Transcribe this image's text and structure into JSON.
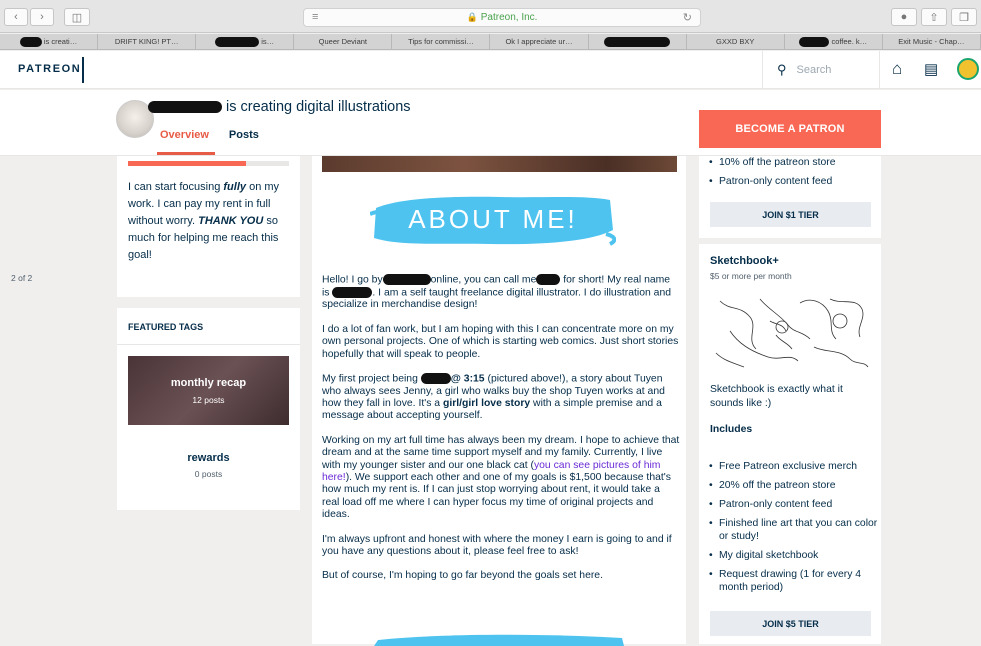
{
  "browser": {
    "address": "Patreon, Inc.",
    "tabs": [
      " is creati…",
      "DRIFT KING! PT…",
      "is…",
      "Queer Deviant",
      "Tips for commissi…",
      "Ok I appreciate ur…",
      "",
      "GXXD BXY",
      "coffee. k…",
      "Exit Music - Chap…"
    ]
  },
  "header": {
    "logo": "PATREON",
    "search_placeholder": "Search"
  },
  "creator": {
    "title_suffix": "is creating digital illustrations",
    "nav": {
      "overview": "Overview",
      "posts": "Posts"
    },
    "become_patron": "BECOME A PATRON"
  },
  "goal": {
    "progress": 0.73,
    "line1_pre": "I can start focusing ",
    "line1_em": "fully",
    "line1_post": " on my work. I can pay my rent in full without worry. ",
    "thanks": "THANK YOU",
    "line2": " so much for helping me reach this goal!",
    "count": "2 of 2"
  },
  "tags": {
    "title": "FEATURED TAGS",
    "items": [
      {
        "name": "monthly recap",
        "count": "12 posts"
      },
      {
        "name": "rewards",
        "count": "0 posts"
      }
    ]
  },
  "post": {
    "banner_text": "ABOUT ME!",
    "p1_a": "Hello! I go by",
    "p1_b": "online, you can call me",
    "p1_c": "for short! My real name is",
    "p1_d": ". I am a self taught freelance digital illustrator. I do illustration and specialize in merchandise design!",
    "p2": "I do a lot of fan work, but I am hoping with this I can concentrate more on my own personal projects. One of which is starting web comics. Just short stories hopefully that will speak to people.",
    "p3_a": "My first project being",
    "p3_bold1": "@ 3:15",
    "p3_b": " (pictured above!), a story about Tuyen who always sees Jenny, a girl who walks buy the shop Tuyen works at and how they fall in love. It's a ",
    "p3_bold2": "girl/girl love story",
    "p3_c": " with a simple premise and a message about accepting yourself.",
    "p4_a": "Working on my art full time has always been my dream. I hope to achieve that dream and at the same time support myself and my family. Currently, I live with my younger sister and our one black cat (",
    "p4_link": "you can see pictures of him here!",
    "p4_b": "). We support each other and one of my goals is $1,500 because that's how much my rent is. If I can just stop worrying about rent, it would take a real load off me where I can hyper focus my time of original projects and ideas.",
    "p5": "I'm always upfront and honest with where the money I earn is going to and if you have any questions about it, please feel free to ask!",
    "p6": "But of course, I'm hoping to go far beyond the goals set here."
  },
  "tier1": {
    "benefits": [
      "10% off the patreon store",
      "Patron-only content feed"
    ],
    "join": "JOIN $1 TIER"
  },
  "tier2": {
    "name": "Sketchbook+",
    "price": "$5 or more per month",
    "description": "Sketchbook is exactly what it sounds like :)",
    "includes": "Includes",
    "benefits": [
      "Free Patreon exclusive merch",
      "20% off the patreon store",
      "Patron-only content feed",
      "Finished line art that you can color or study!",
      "My digital sketchbook",
      "Request drawing (1 for every 4 month period)"
    ],
    "join": "JOIN $5 TIER"
  },
  "colors": {
    "brand": "#f96854",
    "navy": "#052d49",
    "banner_blue": "#4ec3ef",
    "link": "#6a2bd6"
  }
}
